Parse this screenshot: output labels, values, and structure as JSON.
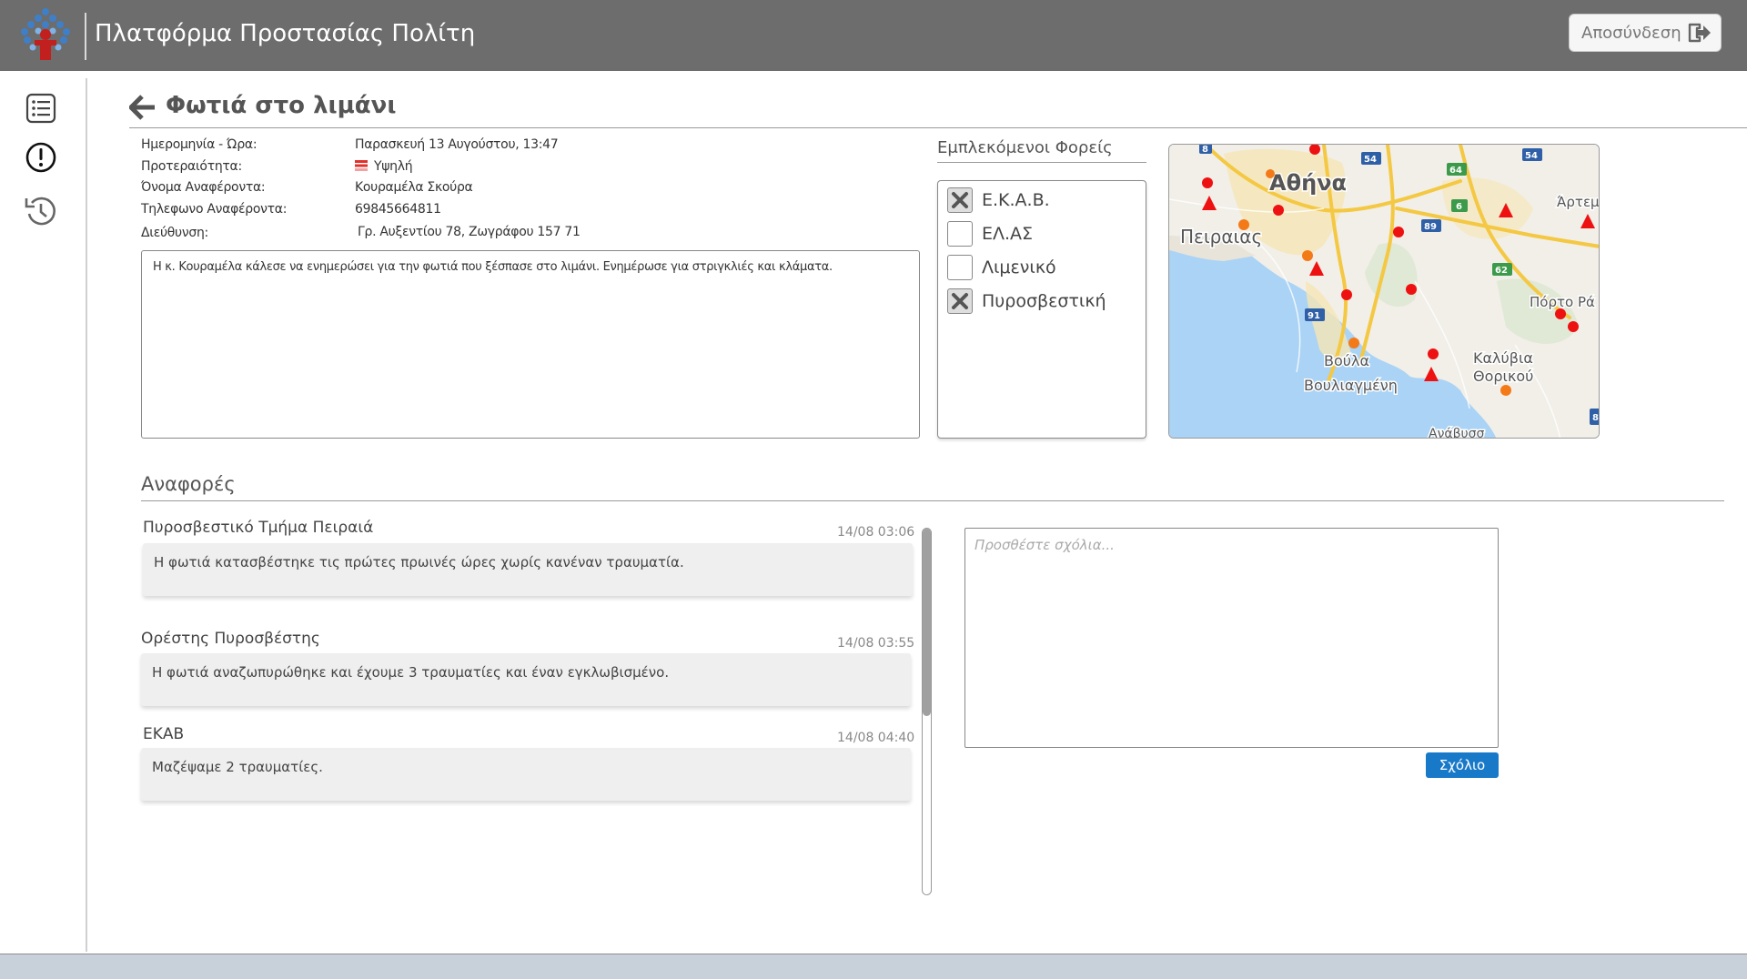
{
  "header": {
    "title": "Πλατφόρμα Προστασίας Πολίτη",
    "logout_label": "Αποσύνδεση"
  },
  "sidebar": {
    "items": [
      {
        "icon": "list-icon"
      },
      {
        "icon": "alert-circle-icon"
      },
      {
        "icon": "history-icon"
      }
    ]
  },
  "incident": {
    "title": "Φωτιά στο λιμάνι",
    "fields": {
      "datetime_label": "Ημερομηνία - Ώρα:",
      "datetime_value": "Παρασκευή 13 Αυγούστου, 13:47",
      "priority_label": "Προτεραιότητα:",
      "priority_value": "Υψηλή",
      "reporter_name_label": "Όνομα Αναφέροντα:",
      "reporter_name_value": "Κουραμέλα Σκούρα",
      "reporter_phone_label": "Τηλεφωνο Αναφέροντα:",
      "reporter_phone_value": "69845664811",
      "address_label": "Διεύθυνση:",
      "address_value": "Γρ. Αυξεντίου 78, Ζωγράφου 157 71"
    },
    "description": "Η κ. Κουραμέλα κάλεσε να ενημερώσει για την φωτιά που ξέσπασε στο λιμάνι. Ενημέρωσε για στριγκλιές και κλάματα.",
    "priority_color": "#e0312b"
  },
  "agencies": {
    "title": "Εμπλεκόμενοι Φορείς",
    "items": [
      {
        "label": "Ε.Κ.Α.Β.",
        "checked": true
      },
      {
        "label": "ΕΛ.ΑΣ",
        "checked": false
      },
      {
        "label": "Λιμενικό",
        "checked": false
      },
      {
        "label": "Πυροσβεστική",
        "checked": true
      }
    ]
  },
  "map": {
    "labels": {
      "athens": "Αθήνα",
      "piraeus": "Πειραιας",
      "voula": "Βούλα",
      "vouliagmeni": "Βουλιαγμένη",
      "kalyvia": "Καλύβια",
      "thorikou": "Θορικού",
      "porto_rafti": "Πόρτο Ρά",
      "artemida": "Άρτεμ",
      "anavyssos": "Ανάβυσσ"
    },
    "road_numbers": [
      "8",
      "54",
      "54",
      "64",
      "6",
      "89",
      "62",
      "91",
      "8"
    ]
  },
  "reports": {
    "title": "Αναφορές",
    "items": [
      {
        "author": "Πυροσβεστικό Τμήμα Πειραιά",
        "time": "14/08 03:06",
        "text": "Η φωτιά κατασβέστηκε τις πρώτες πρωινές ώρες χωρίς κανέναν τραυματία."
      },
      {
        "author": "Ορέστης Πυροσβέστης",
        "time": "14/08 03:55",
        "text": "Η φωτιά αναζωπυρώθηκε και έχουμε 3 τραυματίες και έναν εγκλωβισμένο."
      },
      {
        "author": "ΕΚΑΒ",
        "time": "14/08 04:40",
        "text": "Μαζέψαμε 2 τραυματίες."
      }
    ]
  },
  "comment": {
    "placeholder": "Προσθέστε σχόλια...",
    "value": "",
    "button_label": "Σχόλιο"
  },
  "colors": {
    "header_bg": "#6d6d6d",
    "primary_button": "#1979c9",
    "map_marker_red": "#ee1111",
    "map_marker_orange": "#f47a18"
  }
}
